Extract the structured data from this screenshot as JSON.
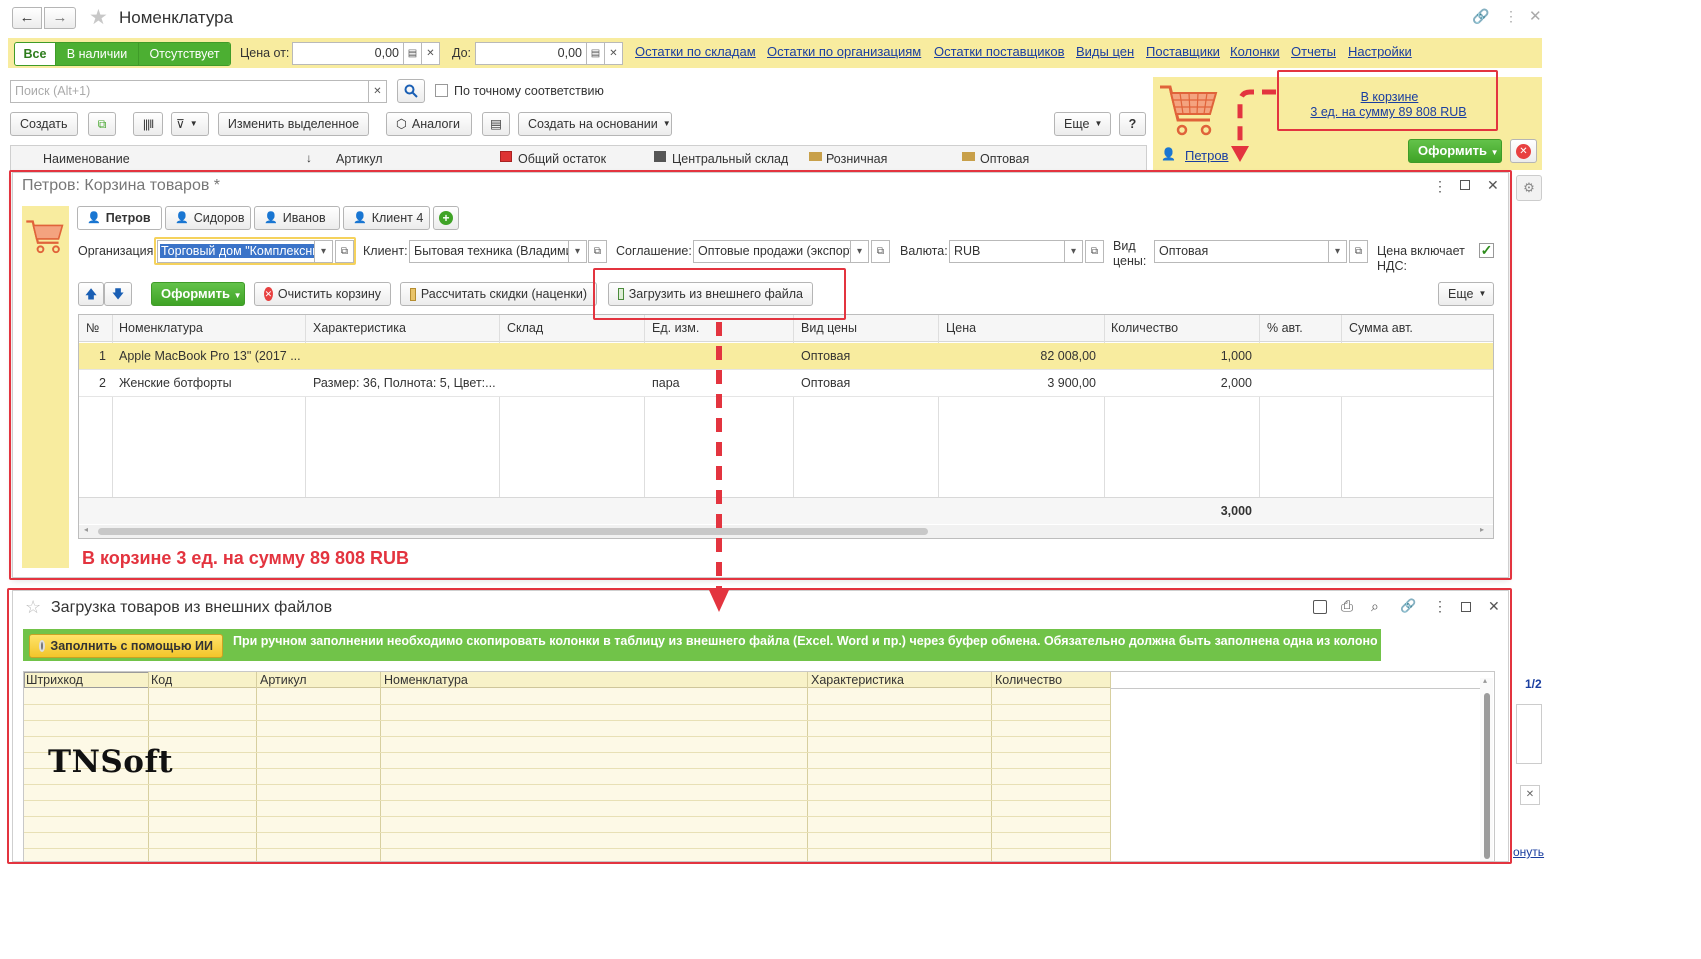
{
  "window": {
    "title": "Номенклатура"
  },
  "filter": {
    "all": "Все",
    "in_stock": "В наличии",
    "absent": "Отсутствует",
    "price_from_label": "Цена от:",
    "price_from": "0,00",
    "price_to_label": "До:",
    "price_to": "0,00"
  },
  "top_links": [
    "Остатки по складам",
    "Остатки по организациям",
    "Остатки поставщиков",
    "Виды цен",
    "Поставщики",
    "Колонки",
    "Отчеты",
    "Настройки"
  ],
  "search": {
    "placeholder": "Поиск (Alt+1)",
    "exact_label": "По точному соответствию"
  },
  "toolbar": {
    "create": "Создать",
    "change_selected": "Изменить выделенное",
    "analogs": "Аналоги",
    "create_based": "Создать на основании",
    "more": "Еще",
    "help": "?"
  },
  "main_table": {
    "columns": [
      "Наименование",
      "Артикул",
      "Общий остаток",
      "Центральный склад",
      "Розничная",
      "Оптовая"
    ]
  },
  "cart_panel": {
    "link_line1": "В корзине",
    "link_line2": "3 ед. на сумму 89 808 RUB",
    "user": "Петров",
    "checkout": "Оформить"
  },
  "side": {
    "page_counter": "1/2",
    "partial_link": "онуть"
  },
  "cart_form": {
    "title": "Петров: Корзина товаров *",
    "tabs": [
      "Петров",
      "Сидоров",
      "Иванов",
      "Клиент 4"
    ],
    "org_label": "Организация:",
    "org_value": "Торговый дом \"Комплексны",
    "client_label": "Клиент:",
    "client_value": "Бытовая техника (Владими",
    "agreement_label": "Соглашение:",
    "agreement_value": "Оптовые продажи (экспорт)",
    "currency_label": "Валюта:",
    "currency_value": "RUB",
    "price_kind_label_1": "Вид",
    "price_kind_label_2": "цены:",
    "price_kind_value": "Оптовая",
    "vat_label_1": "Цена включает",
    "vat_label_2": "НДС:",
    "checkout": "Оформить",
    "clear": "Очистить корзину",
    "calc_discounts": "Рассчитать скидки (наценки)",
    "load_file": "Загрузить из внешнего файла",
    "more": "Еще",
    "columns": [
      "№",
      "Номенклатура",
      "Характеристика",
      "Склад",
      "Ед. изм.",
      "Вид цены",
      "Цена",
      "Количество",
      "% авт.",
      "Сумма авт."
    ],
    "rows": [
      {
        "n": "1",
        "name": "Apple MacBook Pro 13\" (2017 ...",
        "char": "",
        "store": "",
        "unit": "",
        "price_kind": "Оптовая",
        "price": "82 008,00",
        "qty": "1,000"
      },
      {
        "n": "2",
        "name": "Женские ботфорты",
        "char": "Размер: 36, Полнота: 5, Цвет:...",
        "store": "",
        "unit": "пара",
        "price_kind": "Оптовая",
        "price": "3 900,00",
        "qty": "2,000"
      }
    ],
    "total_qty": "3,000",
    "summary": "В корзине 3 ед. на сумму 89 808 RUB"
  },
  "import_form": {
    "title": "Загрузка товаров из внешних файлов",
    "ai_button": "Заполнить с помощью ИИ",
    "hint": "При ручном заполнении необходимо скопировать колонки в таблицу из внешнего файла (Excel. Word и пр.) через буфер обмена. Обязательно должна быть заполнена одна из колонок.",
    "columns": [
      "Штрихкод",
      "Код",
      "Артикул",
      "Номенклатура",
      "Характеристика",
      "Количество"
    ]
  },
  "watermark": "TNSoft",
  "colors": {
    "accent_green": "#4caf32",
    "highlight_yellow": "#f8ec9f",
    "annotation_red": "#e3343f",
    "link_blue": "#1a3ea0"
  }
}
